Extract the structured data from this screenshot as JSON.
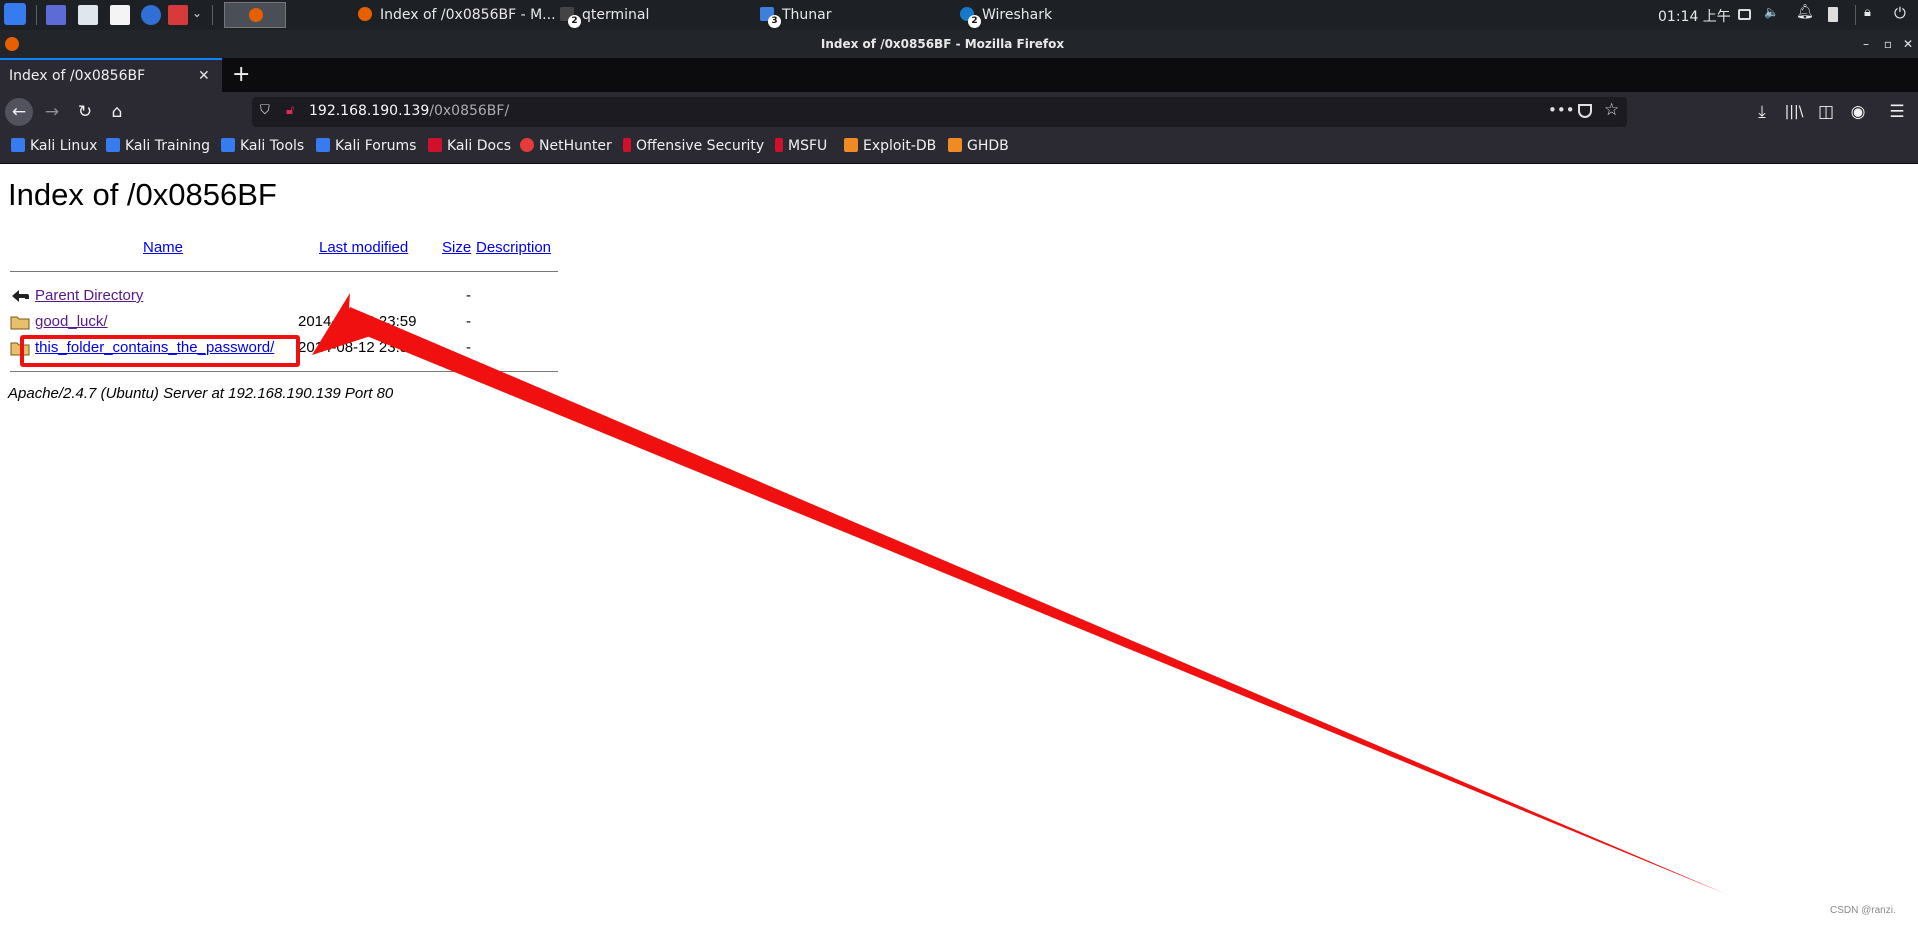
{
  "taskbar": {
    "tasks": [
      {
        "label": "Index of /0x0856BF - M..."
      },
      {
        "label": "qterminal",
        "badge": "2"
      },
      {
        "label": "Thunar",
        "badge": "3"
      },
      {
        "label": "Wireshark",
        "badge": "2"
      }
    ],
    "clock": "01:14 上午"
  },
  "window": {
    "title": "Index of /0x0856BF - Mozilla Firefox"
  },
  "tab": {
    "label": "Index of /0x0856BF"
  },
  "urlbar": {
    "host": "192.168.190.139",
    "path": "/0x0856BF/"
  },
  "bookmarks": [
    {
      "label": "Kali Linux",
      "color": "#367bf0"
    },
    {
      "label": "Kali Training",
      "color": "#367bf0"
    },
    {
      "label": "Kali Tools",
      "color": "#367bf0"
    },
    {
      "label": "Kali Forums",
      "color": "#367bf0"
    },
    {
      "label": "Kali Docs",
      "color": "#d0112b"
    },
    {
      "label": "NetHunter",
      "color": "#e63b3b"
    },
    {
      "label": "Offensive Security",
      "color": "#d0112b"
    },
    {
      "label": "MSFU",
      "color": "#d0112b"
    },
    {
      "label": "Exploit-DB",
      "color": "#f08a24"
    },
    {
      "label": "GHDB",
      "color": "#f08a24"
    }
  ],
  "page": {
    "heading": "Index of /0x0856BF",
    "columns": {
      "name": "Name",
      "modified": "Last modified",
      "size": "Size",
      "description": "Description"
    },
    "rows": [
      {
        "name": "Parent Directory",
        "modified": "",
        "size": "-",
        "icon": "back-icon"
      },
      {
        "name": "good_luck/",
        "modified": "2014-08-12 23:59",
        "size": "-",
        "icon": "folder-icon"
      },
      {
        "name": "this_folder_contains_the_password/",
        "modified": "2014-08-12 23:58",
        "size": "-",
        "icon": "folder-icon"
      }
    ],
    "server": "Apache/2.4.7 (Ubuntu) Server at 192.168.190.139 Port 80"
  },
  "annotation": {
    "color": "#f01010"
  },
  "watermark": "CSDN @ranzi."
}
